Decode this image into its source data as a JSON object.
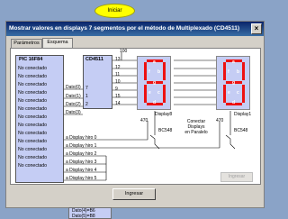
{
  "start_button": "Iniciar",
  "window": {
    "title": "Mostrar valores en displays 7 segmentos por el método de Multiplexado (CD4511)",
    "close_glyph": "×",
    "tabs": [
      "Parámetros",
      "Esquema"
    ],
    "bottom_button": "Ingresar",
    "disabled_button": "Ingresar"
  },
  "pic": {
    "title": "PIC 16F84",
    "pins": [
      "No conectado",
      "No conectado",
      "No conectado",
      "No conectado",
      "No conectado",
      "No conectado",
      "No conectado",
      "No conectado",
      "No conectado",
      "No conectado",
      "No conectado",
      "No conectado",
      "No conectado"
    ]
  },
  "data_labels": [
    "Dato(0)",
    "Dato(1)",
    "Dato(2)",
    "Dato(3)"
  ],
  "display_lines": [
    "a Display hiro 0",
    "a Display hiro 1",
    "a Display hiro 2",
    "a Display hiro 3",
    "a Display hiro 4",
    "a Display hiro 5",
    "a Display hiro 6",
    "a Display hiro 7"
  ],
  "ic": {
    "title": "CD4511",
    "pins": [
      "7",
      "1",
      "2",
      "6"
    ]
  },
  "pin_numbers": [
    "13",
    "12",
    "11",
    "10",
    "9",
    "15",
    "14"
  ],
  "resistor": "100",
  "displays": {
    "left": "Display8",
    "right": "Display1",
    "left_res": "470",
    "right_res": "470",
    "left_tr": "BC548",
    "right_tr": "BC548",
    "segment_letters": [
      "a",
      "b",
      "c",
      "d",
      "e",
      "f",
      "g"
    ]
  },
  "connect_text": [
    "Conectar",
    "Displays",
    "en Paralelo"
  ],
  "tooltip_lines": [
    "Dato(4)=B6",
    "Dato(5)=B8"
  ]
}
